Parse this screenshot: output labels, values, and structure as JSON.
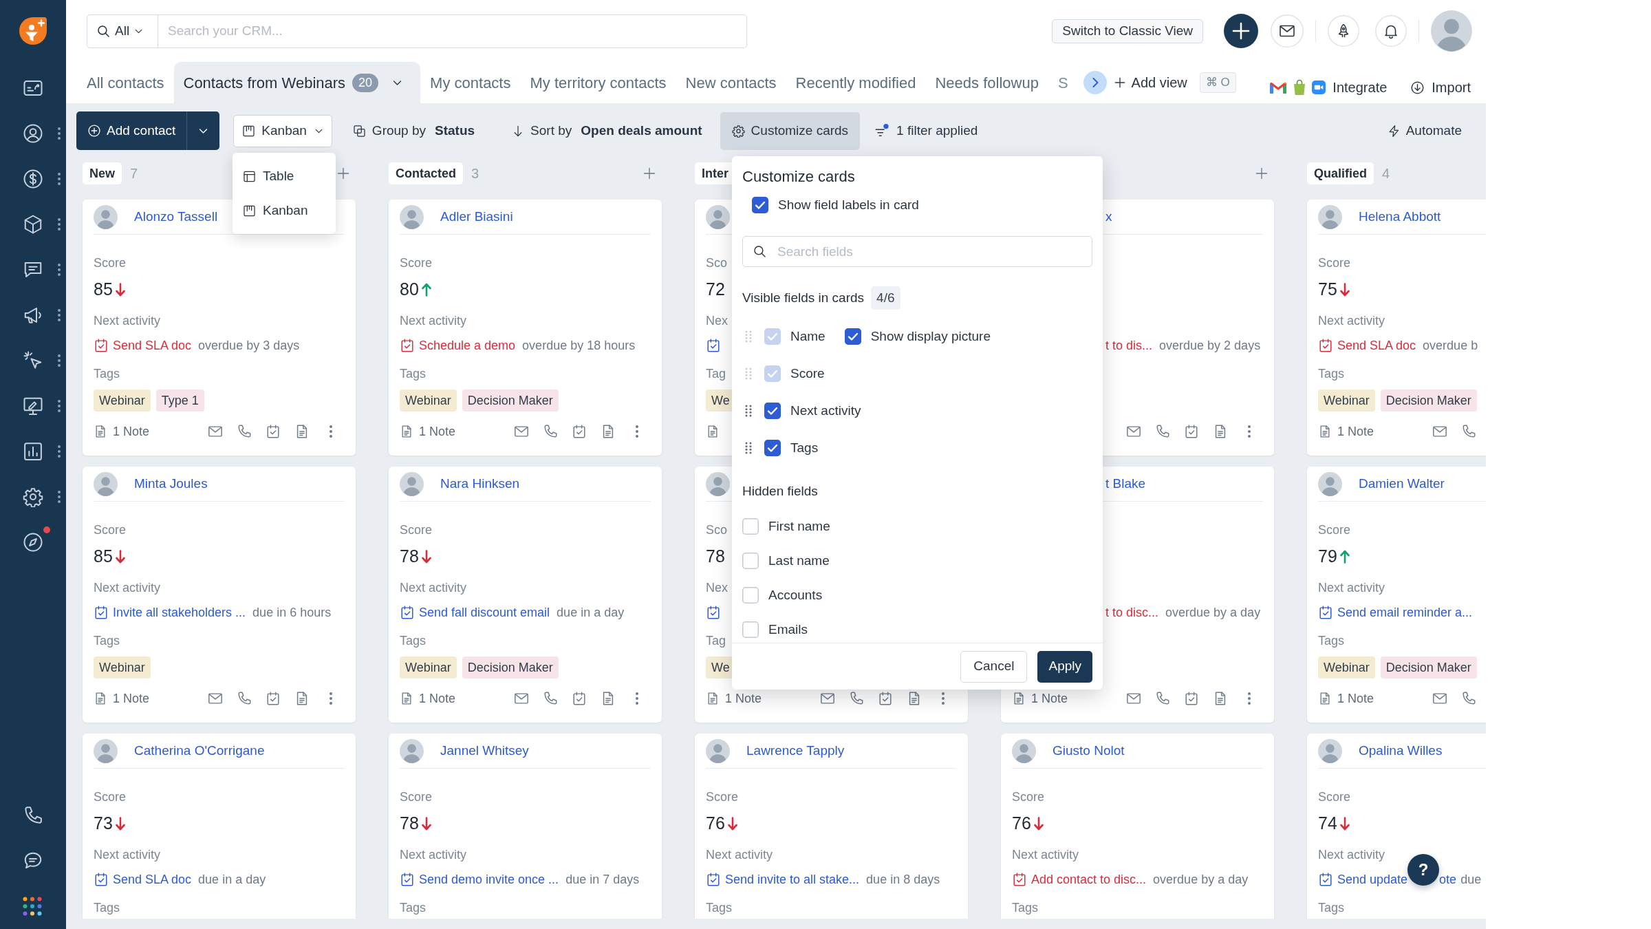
{
  "sidebar": {
    "items": [
      {
        "menu": false,
        "alert": false
      },
      {
        "menu": true,
        "alert": false
      },
      {
        "menu": true,
        "alert": false
      },
      {
        "menu": true,
        "alert": false
      },
      {
        "menu": true,
        "alert": false
      },
      {
        "menu": true,
        "alert": false
      },
      {
        "menu": true,
        "alert": false
      },
      {
        "menu": true,
        "alert": false
      },
      {
        "menu": true,
        "alert": false
      },
      {
        "menu": true,
        "alert": false
      },
      {
        "menu": false,
        "alert": true
      }
    ]
  },
  "search": {
    "scope": "All",
    "placeholder": "Search your CRM..."
  },
  "classic_view": "Switch to Classic View",
  "tabs": [
    {
      "label": "All contacts",
      "selected": false,
      "faded": false
    },
    {
      "label": "Contacts from Webinars",
      "count": "20",
      "selected": true,
      "faded": false
    },
    {
      "label": "My contacts",
      "selected": false,
      "faded": false
    },
    {
      "label": "My territory contacts",
      "selected": false,
      "faded": false
    },
    {
      "label": "New contacts",
      "selected": false,
      "faded": false
    },
    {
      "label": "Recently modified",
      "selected": false,
      "faded": false
    },
    {
      "label": "Needs followup",
      "selected": false,
      "faded": false
    },
    {
      "label": "S",
      "selected": false,
      "faded": true
    }
  ],
  "add_view": "Add view",
  "shortcut": "⌘ O",
  "integrate": "Integrate",
  "import": "Import",
  "toolbar": {
    "add_contact": "Add contact",
    "view": "Kanban",
    "group_by": {
      "label": "Group by",
      "value": "Status"
    },
    "sort_by": {
      "label": "Sort by",
      "value": "Open deals amount"
    },
    "customize": {
      "label": "Customize cards",
      "active": true
    },
    "filter": "1 filter applied",
    "automate": "Automate"
  },
  "view_menu": {
    "open": true,
    "items": [
      {
        "label": "Table",
        "selected": false
      },
      {
        "label": "Kanban",
        "selected": false
      }
    ]
  },
  "columns": [
    {
      "title": "New",
      "count": "7",
      "cards": [
        {
          "kind": "full",
          "name": "Alonzo Tassell",
          "score_label": "Score",
          "score": "85",
          "rising": false,
          "activity_label": "Next activity",
          "activity": "Send SLA doc",
          "due": "overdue by 3 days",
          "overdue": true,
          "tags_label": "Tags",
          "tags": [
            {
              "label": "Webinar",
              "color": "#f3ecd3"
            },
            {
              "label": "Type 1",
              "color": "#f7e4e8"
            }
          ],
          "note": "1 Note"
        },
        {
          "kind": "full",
          "name": "Minta Joules",
          "score_label": "Score",
          "score": "85",
          "rising": false,
          "activity_label": "Next activity",
          "activity": "Invite all stakeholders ...",
          "due": "due in 6 hours",
          "overdue": false,
          "tags_label": "Tags",
          "tags": [
            {
              "label": "Webinar",
              "color": "#f3ecd3"
            }
          ],
          "note": "1 Note"
        },
        {
          "kind": "full",
          "name": "Catherina O'Corrigane",
          "score_label": "Score",
          "score": "73",
          "rising": false,
          "activity_label": "Next activity",
          "activity": "Send SLA doc",
          "due": "due in a day",
          "overdue": false,
          "tags_label": "Tags"
        }
      ]
    },
    {
      "title": "Contacted",
      "count": "3",
      "cards": [
        {
          "kind": "full",
          "name": "Adler Biasini",
          "score_label": "Score",
          "score": "80",
          "rising": true,
          "activity_label": "Next activity",
          "activity": "Schedule a demo",
          "due": "overdue by 18 hours",
          "overdue": true,
          "tags_label": "Tags",
          "tags": [
            {
              "label": "Webinar",
              "color": "#f3ecd3"
            },
            {
              "label": "Decision Maker",
              "color": "#f7e4e8"
            }
          ],
          "note": "1 Note"
        },
        {
          "kind": "full",
          "name": "Nara Hinksen",
          "score_label": "Score",
          "score": "78",
          "rising": false,
          "activity_label": "Next activity",
          "activity": "Send fall discount email",
          "due": "due in a day",
          "overdue": false,
          "tags_label": "Tags",
          "tags": [
            {
              "label": "Webinar",
              "color": "#f3ecd3"
            },
            {
              "label": "Decision Maker",
              "color": "#f7e4e8"
            }
          ],
          "note": "1 Note"
        },
        {
          "kind": "full",
          "name": "Jannel Whitsey",
          "score_label": "Score",
          "score": "78",
          "rising": false,
          "activity_label": "Next activity",
          "activity": "Send demo invite once ...",
          "due": "due in 7 days",
          "overdue": false,
          "tags_label": "Tags"
        }
      ]
    },
    {
      "title": "Inter",
      "cards": [
        {
          "kind": "full",
          "score_label": "Sco",
          "score": "72",
          "activity_label": "Nex",
          "overdue": false,
          "tags_label": "Tag",
          "tags": [
            {
              "label": "We",
              "color": "#f3ecd3"
            }
          ]
        },
        {
          "kind": "full",
          "score_label": "Sco",
          "score": "78",
          "activity_label": "Nex",
          "overdue": false,
          "tags_label": "Tag",
          "tags": [
            {
              "label": "We",
              "color": "#f3ecd3"
            }
          ],
          "note": "1 Note"
        },
        {
          "kind": "full",
          "name": "Lawrence Tapply",
          "score_label": "Score",
          "score": "76",
          "rising": false,
          "activity_label": "Next activity",
          "activity": "Send invite to all stake...",
          "due": "due in 8 days",
          "overdue": false,
          "tags_label": "Tags"
        }
      ]
    },
    {
      "cards": [
        {
          "kind": "tail",
          "name": "x",
          "activity": "t to dis...",
          "due": "overdue by 2 days",
          "overdue": true
        },
        {
          "kind": "tail",
          "name": "t Blake",
          "activity": "t to disc...",
          "due": "overdue by a day",
          "overdue": true,
          "note": "1 Note"
        },
        {
          "kind": "full",
          "name": "Giusto Nolot",
          "score_label": "Score",
          "score": "76",
          "rising": false,
          "activity_label": "Next activity",
          "activity": "Add contact to disc...",
          "due": "overdue by a day",
          "overdue": true,
          "tags_label": "Tags"
        }
      ]
    },
    {
      "title": "Qualified",
      "count": "4",
      "cards": [
        {
          "kind": "full",
          "name": "Helena Abbott",
          "score_label": "Score",
          "score": "75",
          "rising": false,
          "activity_label": "Next activity",
          "activity": "Send SLA doc",
          "due": "overdue b",
          "overdue": true,
          "tags_label": "Tags",
          "tags": [
            {
              "label": "Webinar",
              "color": "#f3ecd3"
            },
            {
              "label": "Decision Maker",
              "color": "#f7e4e8"
            }
          ],
          "note": "1 Note"
        },
        {
          "kind": "full",
          "name": "Damien Walter",
          "score_label": "Score",
          "score": "79",
          "rising": true,
          "activity_label": "Next activity",
          "activity": "Send email reminder a...",
          "overdue": false,
          "tags_label": "Tags",
          "tags": [
            {
              "label": "Webinar",
              "color": "#f3ecd3"
            },
            {
              "label": "Decision Maker",
              "color": "#f7e4e8"
            }
          ],
          "note": "1 Note"
        },
        {
          "kind": "full",
          "name": "Opalina Willes",
          "score_label": "Score",
          "score": "74",
          "rising": false,
          "activity_label": "Next activity",
          "activity": "Send update",
          "activity_tail": "ote",
          "due": "due",
          "overdue": false,
          "tags_label": "Tags"
        }
      ]
    }
  ],
  "customize_panel": {
    "title": "Customize cards",
    "show_labels": {
      "label": "Show field labels in card",
      "checked": true
    },
    "search_placeholder": "Search fields",
    "visible_title": "Visible fields in cards",
    "visible_count": "4/6",
    "visible_fields": [
      {
        "label": "Name",
        "checked": true,
        "disabled": true,
        "option": {
          "label": "Show display picture",
          "checked": true
        }
      },
      {
        "label": "Score",
        "checked": true,
        "disabled": true
      },
      {
        "label": "Next activity",
        "checked": true,
        "disabled": false
      },
      {
        "label": "Tags",
        "checked": true,
        "disabled": false
      }
    ],
    "hidden_title": "Hidden fields",
    "hidden_fields": [
      {
        "label": "First name",
        "checked": false
      },
      {
        "label": "Last name",
        "checked": false
      },
      {
        "label": "Accounts",
        "checked": false
      },
      {
        "label": "Emails",
        "checked": false
      }
    ],
    "cancel": "Cancel",
    "apply": "Apply"
  },
  "help": "?"
}
